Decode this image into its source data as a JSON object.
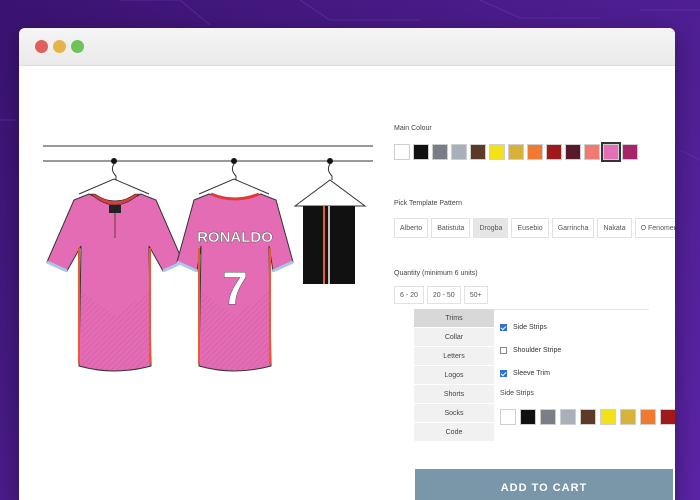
{
  "main_colour": {
    "label": "Main Colour",
    "swatches": [
      "#ffffff",
      "#111111",
      "#7a7f87",
      "#a9b0b9",
      "#5b3b28",
      "#f1e21a",
      "#d9b23b",
      "#f07a32",
      "#a11a1a",
      "#5a1a2b",
      "#ef7a72",
      "#e56fb7",
      "#a8246b"
    ],
    "selected_index": 11
  },
  "template": {
    "label": "Pick Template Pattern",
    "patterns": [
      "Alberto",
      "Batistuta",
      "Drogba",
      "Eusebio",
      "Garrincha",
      "Nakata",
      "O Fenomeno"
    ],
    "active_index": 2
  },
  "quantity": {
    "label": "Quantity (minimum 6 units)",
    "options": [
      "6 - 20",
      "20 - 50",
      "50+"
    ]
  },
  "tabs": [
    "Trims",
    "Collar",
    "Letters",
    "Logos",
    "Shorts",
    "Socks",
    "Code"
  ],
  "active_tab": 0,
  "trims": [
    {
      "label": "Side Strips",
      "checked": true
    },
    {
      "label": "Shoulder Stripe",
      "checked": false
    },
    {
      "label": "Sleeve Trim",
      "checked": true
    }
  ],
  "side_strips": {
    "label": "Side Strips",
    "swatches": [
      "#ffffff",
      "#111111",
      "#7a7f87",
      "#a9b0b9",
      "#5b3b28",
      "#f1e21a",
      "#d9b23b",
      "#f07a32",
      "#a11a1a"
    ]
  },
  "jersey": {
    "name": "RONALDO",
    "number": "7",
    "shirt_colour": "#e36cb4",
    "trim_colour": "#e03a3a"
  },
  "cart_label": "ADD TO CART"
}
